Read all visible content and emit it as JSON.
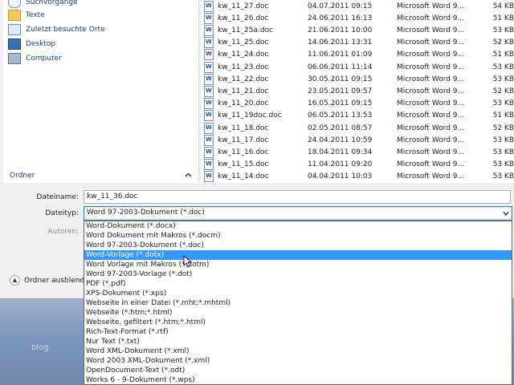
{
  "nav": {
    "items": [
      {
        "label": "Suchvorgänge",
        "icon": "search-folder-icon"
      },
      {
        "label": "Texte",
        "icon": "folder-icon"
      },
      {
        "label": "Zuletzt besuchte Orte",
        "icon": "recent-places-icon"
      },
      {
        "label": "Desktop",
        "icon": "desktop-icon"
      },
      {
        "label": "Computer",
        "icon": "computer-icon"
      }
    ],
    "folder_label": "Ordner"
  },
  "files": [
    {
      "name": "kw_11_27.doc",
      "date": "04.07.2011 09:15",
      "type": "Microsoft Word 9...",
      "size": "54 KB"
    },
    {
      "name": "kw_11_26.doc",
      "date": "24.06.2011 16:13",
      "type": "Microsoft Word 9...",
      "size": "51 KB"
    },
    {
      "name": "kw_11_25a.doc",
      "date": "21.06.2011 10:00",
      "type": "Microsoft Word 9...",
      "size": "53 KB"
    },
    {
      "name": "kw_11_25.doc",
      "date": "14.06.2011 13:31",
      "type": "Microsoft Word 9...",
      "size": "52 KB"
    },
    {
      "name": "kw_11_24.doc",
      "date": "11.06.2011 01:09",
      "type": "Microsoft Word 9...",
      "size": "51 KB"
    },
    {
      "name": "kw_11_23.doc",
      "date": "06.06.2011 11:14",
      "type": "Microsoft Word 9...",
      "size": "53 KB"
    },
    {
      "name": "kw_11_22.doc",
      "date": "30.05.2011 09:15",
      "type": "Microsoft Word 9...",
      "size": "53 KB"
    },
    {
      "name": "kw_11_21.doc",
      "date": "23.05.2011 09:57",
      "type": "Microsoft Word 9...",
      "size": "52 KB"
    },
    {
      "name": "kw_11_20.doc",
      "date": "16.05.2011 09:15",
      "type": "Microsoft Word 9...",
      "size": "53 KB"
    },
    {
      "name": "kw_11_19doc.doc",
      "date": "06.05.2011 13:53",
      "type": "Microsoft Word 9...",
      "size": "51 KB"
    },
    {
      "name": "kw_11_18.doc",
      "date": "02.05.2011 08:57",
      "type": "Microsoft Word 9...",
      "size": "52 KB"
    },
    {
      "name": "kw_11_17.doc",
      "date": "24.04.2011 10:59",
      "type": "Microsoft Word 9...",
      "size": "53 KB"
    },
    {
      "name": "kw_11_16.doc",
      "date": "18.04.2011 09:34",
      "type": "Microsoft Word 9...",
      "size": "53 KB"
    },
    {
      "name": "kw_11_15.doc",
      "date": "11.04.2011 09:20",
      "type": "Microsoft Word 9...",
      "size": "53 KB"
    },
    {
      "name": "kw_11_14.doc",
      "date": "04.04.2011 10:03",
      "type": "Microsoft Word 9...",
      "size": "53 KB"
    }
  ],
  "form": {
    "filename_label": "Dateiname:",
    "filename_value": "kw_11_36.doc",
    "filetype_label": "Dateityp:",
    "filetype_value": "Word 97-2003-Dokument (*.doc)",
    "authors_label": "Autoren:"
  },
  "filetype_options": [
    "Word-Dokument (*.docx)",
    "Word Dokument mit Makros (*.docm)",
    "Word 97-2003-Dokument (*.doc)",
    "Word-Vorlage (*.dotx)",
    "Word Vorlage mit Makros (*.dotm)",
    "Word 97-2003-Vorlage (*.dot)",
    "PDF (*.pdf)",
    "XPS-Dokument (*.xps)",
    "Webseite in einer Datei (*.mht;*.mhtml)",
    "Webseite (*.htm;*.html)",
    "Webseite, gefiltert (*.htm;*.html)",
    "Rich-Text-Format (*.rtf)",
    "Nur Text (*.txt)",
    "Word XML-Dokument (*.xml)",
    "Word 2003 XML-Dokument (*.xml)",
    "OpenDocument-Text (*.odt)",
    "Works 6 - 9-Dokument (*.wps)"
  ],
  "selected_option_index": 3,
  "hide_folders_label": "Ordner ausblende",
  "desktop_text": "blog",
  "colors": {
    "selection": "#3399ff",
    "nav_link": "#1e3c78"
  }
}
